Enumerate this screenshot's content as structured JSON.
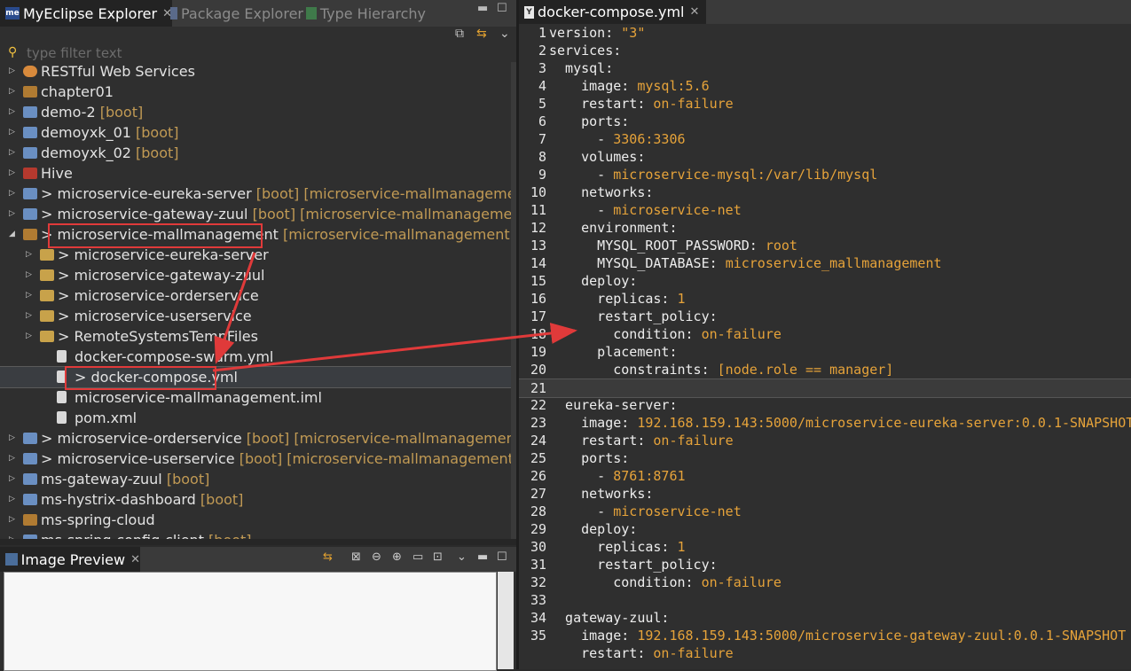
{
  "explorer": {
    "tabs": [
      {
        "label": "MyEclipse Explorer",
        "icon": "myeclipse-icon"
      },
      {
        "label": "Package Explorer",
        "icon": "package-icon"
      },
      {
        "label": "Type Hierarchy",
        "icon": "hierarchy-icon"
      }
    ],
    "filter_placeholder": "type filter text",
    "tree": [
      {
        "label": "RESTful Web Services",
        "tag": "",
        "indent": 0,
        "icon": "globe",
        "expanded": false
      },
      {
        "label": "chapter01",
        "tag": "",
        "indent": 0,
        "icon": "proj",
        "expanded": false
      },
      {
        "label": "demo-2",
        "tag": " [boot]",
        "indent": 0,
        "icon": "boot",
        "expanded": false
      },
      {
        "label": "demoyxk_01",
        "tag": " [boot]",
        "indent": 0,
        "icon": "boot",
        "expanded": false
      },
      {
        "label": "demoyxk_02",
        "tag": " [boot]",
        "indent": 0,
        "icon": "boot",
        "expanded": false
      },
      {
        "label": "Hive",
        "tag": "",
        "indent": 0,
        "icon": "hive",
        "expanded": false
      },
      {
        "label": "> microservice-eureka-server",
        "tag": " [boot] [microservice-mallmanagement mas",
        "indent": 0,
        "icon": "boot",
        "expanded": false
      },
      {
        "label": "> microservice-gateway-zuul",
        "tag": " [boot] [microservice-mallmanagement mast",
        "indent": 0,
        "icon": "boot",
        "expanded": false
      },
      {
        "label": "> microservice-mallmanagement",
        "tag": "  [microservice-mallmanagement master]",
        "indent": 0,
        "icon": "proj",
        "expanded": true
      },
      {
        "label": "> microservice-eureka-server",
        "tag": "",
        "indent": 1,
        "icon": "folder",
        "expanded": false
      },
      {
        "label": "> microservice-gateway-zuul",
        "tag": "",
        "indent": 1,
        "icon": "folder",
        "expanded": false
      },
      {
        "label": "> microservice-orderservice",
        "tag": "",
        "indent": 1,
        "icon": "folder",
        "expanded": false
      },
      {
        "label": "> microservice-userservice",
        "tag": "",
        "indent": 1,
        "icon": "folder",
        "expanded": false
      },
      {
        "label": "> RemoteSystemsTempFiles",
        "tag": "",
        "indent": 1,
        "icon": "folder",
        "expanded": false
      },
      {
        "label": "docker-compose-swarm.yml",
        "tag": "",
        "indent": 2,
        "icon": "file",
        "expanded": null
      },
      {
        "label": "> docker-compose.yml",
        "tag": "",
        "indent": 2,
        "icon": "file",
        "expanded": null,
        "selected": true
      },
      {
        "label": "microservice-mallmanagement.iml",
        "tag": "",
        "indent": 2,
        "icon": "file",
        "expanded": null
      },
      {
        "label": "pom.xml",
        "tag": "",
        "indent": 2,
        "icon": "file",
        "expanded": null
      },
      {
        "label": "> microservice-orderservice",
        "tag": " [boot] [microservice-mallmanagement mast",
        "indent": 0,
        "icon": "boot",
        "expanded": false
      },
      {
        "label": "> microservice-userservice",
        "tag": " [boot] [microservice-mallmanagement maste",
        "indent": 0,
        "icon": "boot",
        "expanded": false
      },
      {
        "label": "ms-gateway-zuul",
        "tag": " [boot]",
        "indent": 0,
        "icon": "boot",
        "expanded": false
      },
      {
        "label": "ms-hystrix-dashboard",
        "tag": " [boot]",
        "indent": 0,
        "icon": "boot",
        "expanded": false
      },
      {
        "label": "ms-spring-cloud",
        "tag": "",
        "indent": 0,
        "icon": "proj",
        "expanded": false
      },
      {
        "label": "ms-spring-config-client",
        "tag": " [boot]",
        "indent": 0,
        "icon": "boot",
        "expanded": false
      }
    ]
  },
  "preview": {
    "tab_label": "Image Preview"
  },
  "editor": {
    "tab_label": "docker-compose.yml",
    "current_line": 21,
    "lines": [
      {
        "n": "1",
        "k": "version: ",
        "v": "\"3\""
      },
      {
        "n": "2",
        "k": "services:",
        "v": ""
      },
      {
        "n": "3",
        "k": "  mysql:",
        "v": ""
      },
      {
        "n": "4",
        "k": "    image: ",
        "v": "mysql:5.6"
      },
      {
        "n": "5",
        "k": "    restart: ",
        "v": "on-failure"
      },
      {
        "n": "6",
        "k": "    ports:",
        "v": ""
      },
      {
        "n": "7",
        "k": "      - ",
        "v": "3306:3306"
      },
      {
        "n": "8",
        "k": "    volumes:",
        "v": ""
      },
      {
        "n": "9",
        "k": "      - ",
        "v": "microservice-mysql:/var/lib/mysql"
      },
      {
        "n": "10",
        "k": "    networks:",
        "v": ""
      },
      {
        "n": "11",
        "k": "      - ",
        "v": "microservice-net"
      },
      {
        "n": "12",
        "k": "    environment:",
        "v": ""
      },
      {
        "n": "13",
        "k": "      MYSQL_ROOT_PASSWORD: ",
        "v": "root"
      },
      {
        "n": "14",
        "k": "      MYSQL_DATABASE: ",
        "v": "microservice_mallmanagement"
      },
      {
        "n": "15",
        "k": "    deploy:",
        "v": ""
      },
      {
        "n": "16",
        "k": "      replicas: ",
        "v": "1"
      },
      {
        "n": "17",
        "k": "      restart_policy:",
        "v": ""
      },
      {
        "n": "18",
        "k": "        condition: ",
        "v": "on-failure"
      },
      {
        "n": "19",
        "k": "      placement:",
        "v": ""
      },
      {
        "n": "20",
        "k": "        constraints: ",
        "v": "[node.role == manager]"
      },
      {
        "n": "21",
        "k": "",
        "v": ""
      },
      {
        "n": "22",
        "k": "  eureka-server:",
        "v": ""
      },
      {
        "n": "23",
        "k": "    image: ",
        "v": "192.168.159.143:5000/microservice-eureka-server:0.0.1-SNAPSHOT"
      },
      {
        "n": "24",
        "k": "    restart: ",
        "v": "on-failure"
      },
      {
        "n": "25",
        "k": "    ports:",
        "v": ""
      },
      {
        "n": "26",
        "k": "      - ",
        "v": "8761:8761"
      },
      {
        "n": "27",
        "k": "    networks:",
        "v": ""
      },
      {
        "n": "28",
        "k": "      - ",
        "v": "microservice-net"
      },
      {
        "n": "29",
        "k": "    deploy:",
        "v": ""
      },
      {
        "n": "30",
        "k": "      replicas: ",
        "v": "1"
      },
      {
        "n": "31",
        "k": "      restart_policy:",
        "v": ""
      },
      {
        "n": "32",
        "k": "        condition: ",
        "v": "on-failure"
      },
      {
        "n": "33",
        "k": "",
        "v": ""
      },
      {
        "n": "34",
        "k": "  gateway-zuul:",
        "v": ""
      },
      {
        "n": "35",
        "k": "    image: ",
        "v": "192.168.159.143:5000/microservice-gateway-zuul:0.0.1-SNAPSHOT"
      },
      {
        "n": "",
        "k": "    restart: ",
        "v": "on-failure"
      }
    ]
  },
  "colors": {
    "highlight_box": "#e03a3a",
    "yaml_value": "#e6a33a",
    "boot_tag": "#c19a54"
  }
}
